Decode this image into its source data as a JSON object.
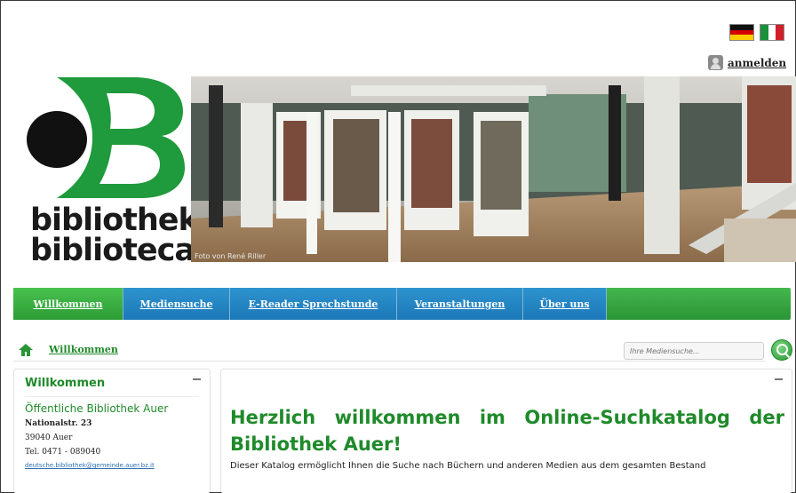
{
  "languages": {
    "german_flag": "de-flag-icon",
    "italian_flag": "it-flag-icon"
  },
  "login": {
    "icon": "user-icon",
    "label": "anmelden"
  },
  "logo": {
    "line1": "bibliothek",
    "line2": "biblioteca",
    "colors": {
      "green": "#1f9a3c",
      "black": "#111111"
    }
  },
  "hero": {
    "credit": "Foto von René Riller"
  },
  "nav": {
    "items": [
      {
        "label": "Willkommen",
        "active": true
      },
      {
        "label": "Mediensuche",
        "active": false
      },
      {
        "label": "E-Reader Sprechstunde",
        "active": false
      },
      {
        "label": "Veranstaltungen",
        "active": false
      },
      {
        "label": "Über uns",
        "active": false
      }
    ],
    "colors": {
      "bar": "#2e9e3a",
      "tab": "#1f7fbf"
    }
  },
  "breadcrumb": {
    "icon": "home-icon",
    "label": "Willkommen"
  },
  "search": {
    "placeholder": "Ihre Mediensuche...",
    "button_icon": "search-icon"
  },
  "sidebar": {
    "title": "Willkommen",
    "library_name": "Öffentliche Bibliothek Auer",
    "street": "Nationalstr. 23",
    "city": "39040 Auer",
    "phone": "Tel. 0471 - 089040",
    "email": "deutsche.bibliothek@gemeinde.auer.bz.it"
  },
  "main": {
    "heading_line1": "Herzlich willkommen im Online-Suchkatalog der",
    "heading_line2": "Bibliothek Auer!",
    "intro": "Dieser Katalog ermöglicht Ihnen die Suche nach Büchern und anderen Medien aus dem gesamten Bestand"
  }
}
